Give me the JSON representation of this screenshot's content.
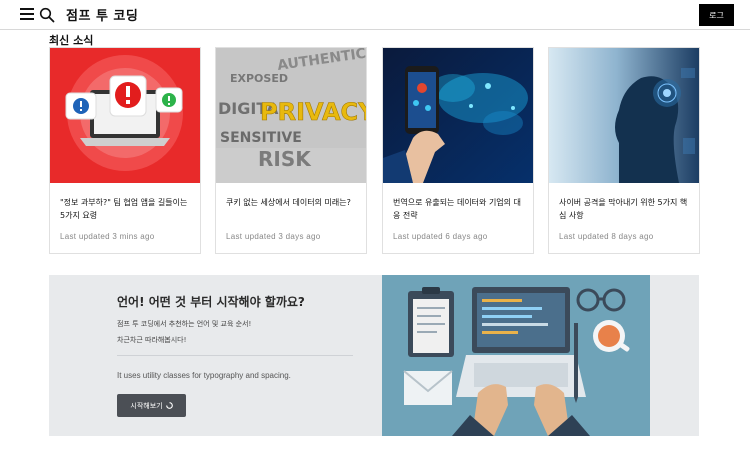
{
  "header": {
    "brand": "점프 투 코딩",
    "login_label": "로그",
    "icons": [
      "menu-icon",
      "search-icon"
    ]
  },
  "section": {
    "title": "최신 소식"
  },
  "cards": [
    {
      "title": "\"정보 과부하?\" 팀 협업 앱을 길들이는 5가지 요령",
      "meta": "Last updated 3 mins ago",
      "image": "alert-laptop-illustration"
    },
    {
      "title": "쿠키 없는 세상에서 데이터의 미래는?",
      "meta": "Last updated 3 days ago",
      "image": "privacy-word-cloud",
      "image_text": [
        "PRIVACY",
        "DIGITAL",
        "RISK",
        "SENSITIVE",
        "EXPOSED",
        "AUTHENTICATION"
      ]
    },
    {
      "title": "번역으로 유출되는 데이터와 기업의 대응 전략",
      "meta": "Last updated 6 days ago",
      "image": "hand-phone-world-map"
    },
    {
      "title": "사이버 공격을 막아내기 위한 5가지 핵심 사항",
      "meta": "Last updated 8 days ago",
      "image": "thinking-silhouette-digital"
    }
  ],
  "banner": {
    "title": "언어! 어떤 것 부터 시작해야 할까요?",
    "desc_line1": "점프 투 코딩에서 추천하는 언어 및 교육 순서!",
    "desc_line2": "차근차근 따라해봅시다!",
    "note": "It uses utility classes for typography and spacing.",
    "button_label": "시작해보기",
    "illustration": "workspace-laptop-illustration",
    "colors": {
      "background": "#e8eaec",
      "illustration_bg": "#6fa3b8",
      "button": "#4b4f55"
    }
  }
}
